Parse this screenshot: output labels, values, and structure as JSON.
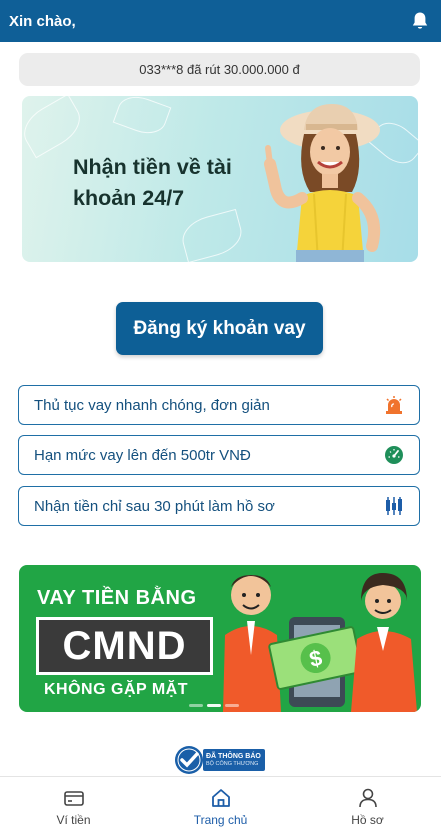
{
  "header": {
    "greeting": "Xin chào,"
  },
  "ticker": {
    "text": "033***8 đã rút 30.000.000 đ"
  },
  "hero_banner": {
    "title": "Nhận tiền về tài khoản 24/7"
  },
  "cta": {
    "label": "Đăng ký khoản vay"
  },
  "features": [
    {
      "label": "Thủ tục vay nhanh chóng, đơn giản",
      "icon": "alarm-icon",
      "color": "#f0732d"
    },
    {
      "label": "Hạn mức vay lên đến 500tr VNĐ",
      "icon": "speedometer-icon",
      "color": "#1f8f5a"
    },
    {
      "label": "Nhận tiền chỉ sau 30 phút làm hồ sơ",
      "icon": "candlestick-icon",
      "color": "#1d5da8"
    }
  ],
  "promo_banner": {
    "headline": "VAY TIỀN BẰNG",
    "highlight": "CMND",
    "subline": "KHÔNG GẶP MẶT",
    "money_symbol": "$"
  },
  "certification_badge": {
    "line1": "ĐÃ THÔNG BÁO",
    "line2": "BỘ CÔNG THƯƠNG"
  },
  "tabbar": {
    "items": [
      {
        "label": "Ví tiền",
        "icon": "wallet-icon",
        "active": false
      },
      {
        "label": "Trang chủ",
        "icon": "home-icon",
        "active": true
      },
      {
        "label": "Hồ sơ",
        "icon": "profile-icon",
        "active": false
      }
    ]
  },
  "colors": {
    "primary": "#0f5f97",
    "promo_green": "#21a545",
    "tab_active": "#1d5da8"
  }
}
